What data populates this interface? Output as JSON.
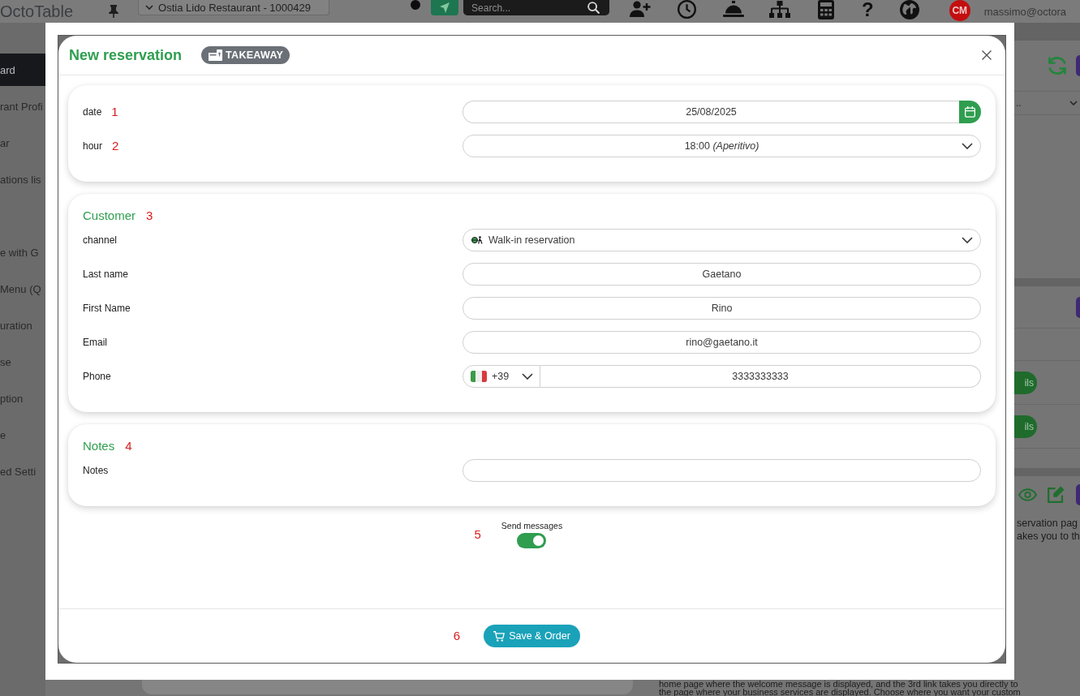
{
  "top_bar": {
    "logo": "OctoTable",
    "restaurant_selector": "Ostia Lido Restaurant - 1000429",
    "search": {
      "placeholder": "Search..."
    },
    "help": "?",
    "avatar": "CM",
    "user_email": "massimo@octora"
  },
  "sidebar": {
    "groups": [
      {
        "items": [
          {
            "label": "ard",
            "selected": true
          },
          {
            "label": "rant Profi",
            "selected": false
          },
          {
            "label": "ar",
            "selected": false
          },
          {
            "label": "ations lis",
            "selected": false
          }
        ]
      },
      {
        "items": [
          {
            "label": "e with G",
            "selected": false
          },
          {
            "label": "Menu (Q",
            "selected": false
          },
          {
            "label": "uration",
            "selected": false
          },
          {
            "label": "se",
            "selected": false
          },
          {
            "label": "ption",
            "selected": false
          },
          {
            "label": "e",
            "selected": false
          },
          {
            "label": "ed Setti",
            "selected": false
          }
        ]
      }
    ]
  },
  "right_panel": {
    "dropdown_value": "..",
    "action_buttons": [
      "ils",
      "ils"
    ],
    "paragraph_lines": [
      "servation pag",
      "akes you to th",
      "home page where the welcome message is displayed, and the 3rd link takes you directly to",
      "the page where your business services are displayed. Choose where you want your custom"
    ]
  },
  "modal": {
    "title": "New reservation",
    "badge": "TAKEAWAY",
    "sections": [
      {
        "fields": [
          {
            "kind": "date",
            "label": "date",
            "marker": "1",
            "value": "25/08/2025"
          },
          {
            "kind": "select",
            "label": "hour",
            "marker": "2",
            "value": "18:00 *(Aperitivo)*"
          }
        ]
      },
      {
        "title": "Customer",
        "marker": "3",
        "fields": [
          {
            "kind": "channel",
            "label": "channel",
            "value": "Walk-in reservation"
          },
          {
            "kind": "text",
            "label": "Last name",
            "value": "Gaetano"
          },
          {
            "kind": "text",
            "label": "First Name",
            "value": "Rino"
          },
          {
            "kind": "text",
            "label": "Email",
            "value": "rino@gaetano.it"
          },
          {
            "kind": "phone",
            "label": "Phone",
            "dial_code": "+39",
            "value": "3333333333"
          }
        ]
      },
      {
        "title": "Notes",
        "marker": "4",
        "fields": [
          {
            "kind": "text",
            "label": "Notes"
          }
        ]
      }
    ],
    "toggle": {
      "label": "Send messages",
      "marker": "5",
      "on": true
    },
    "save_button": {
      "label": "Save & Order",
      "marker": "6"
    }
  }
}
